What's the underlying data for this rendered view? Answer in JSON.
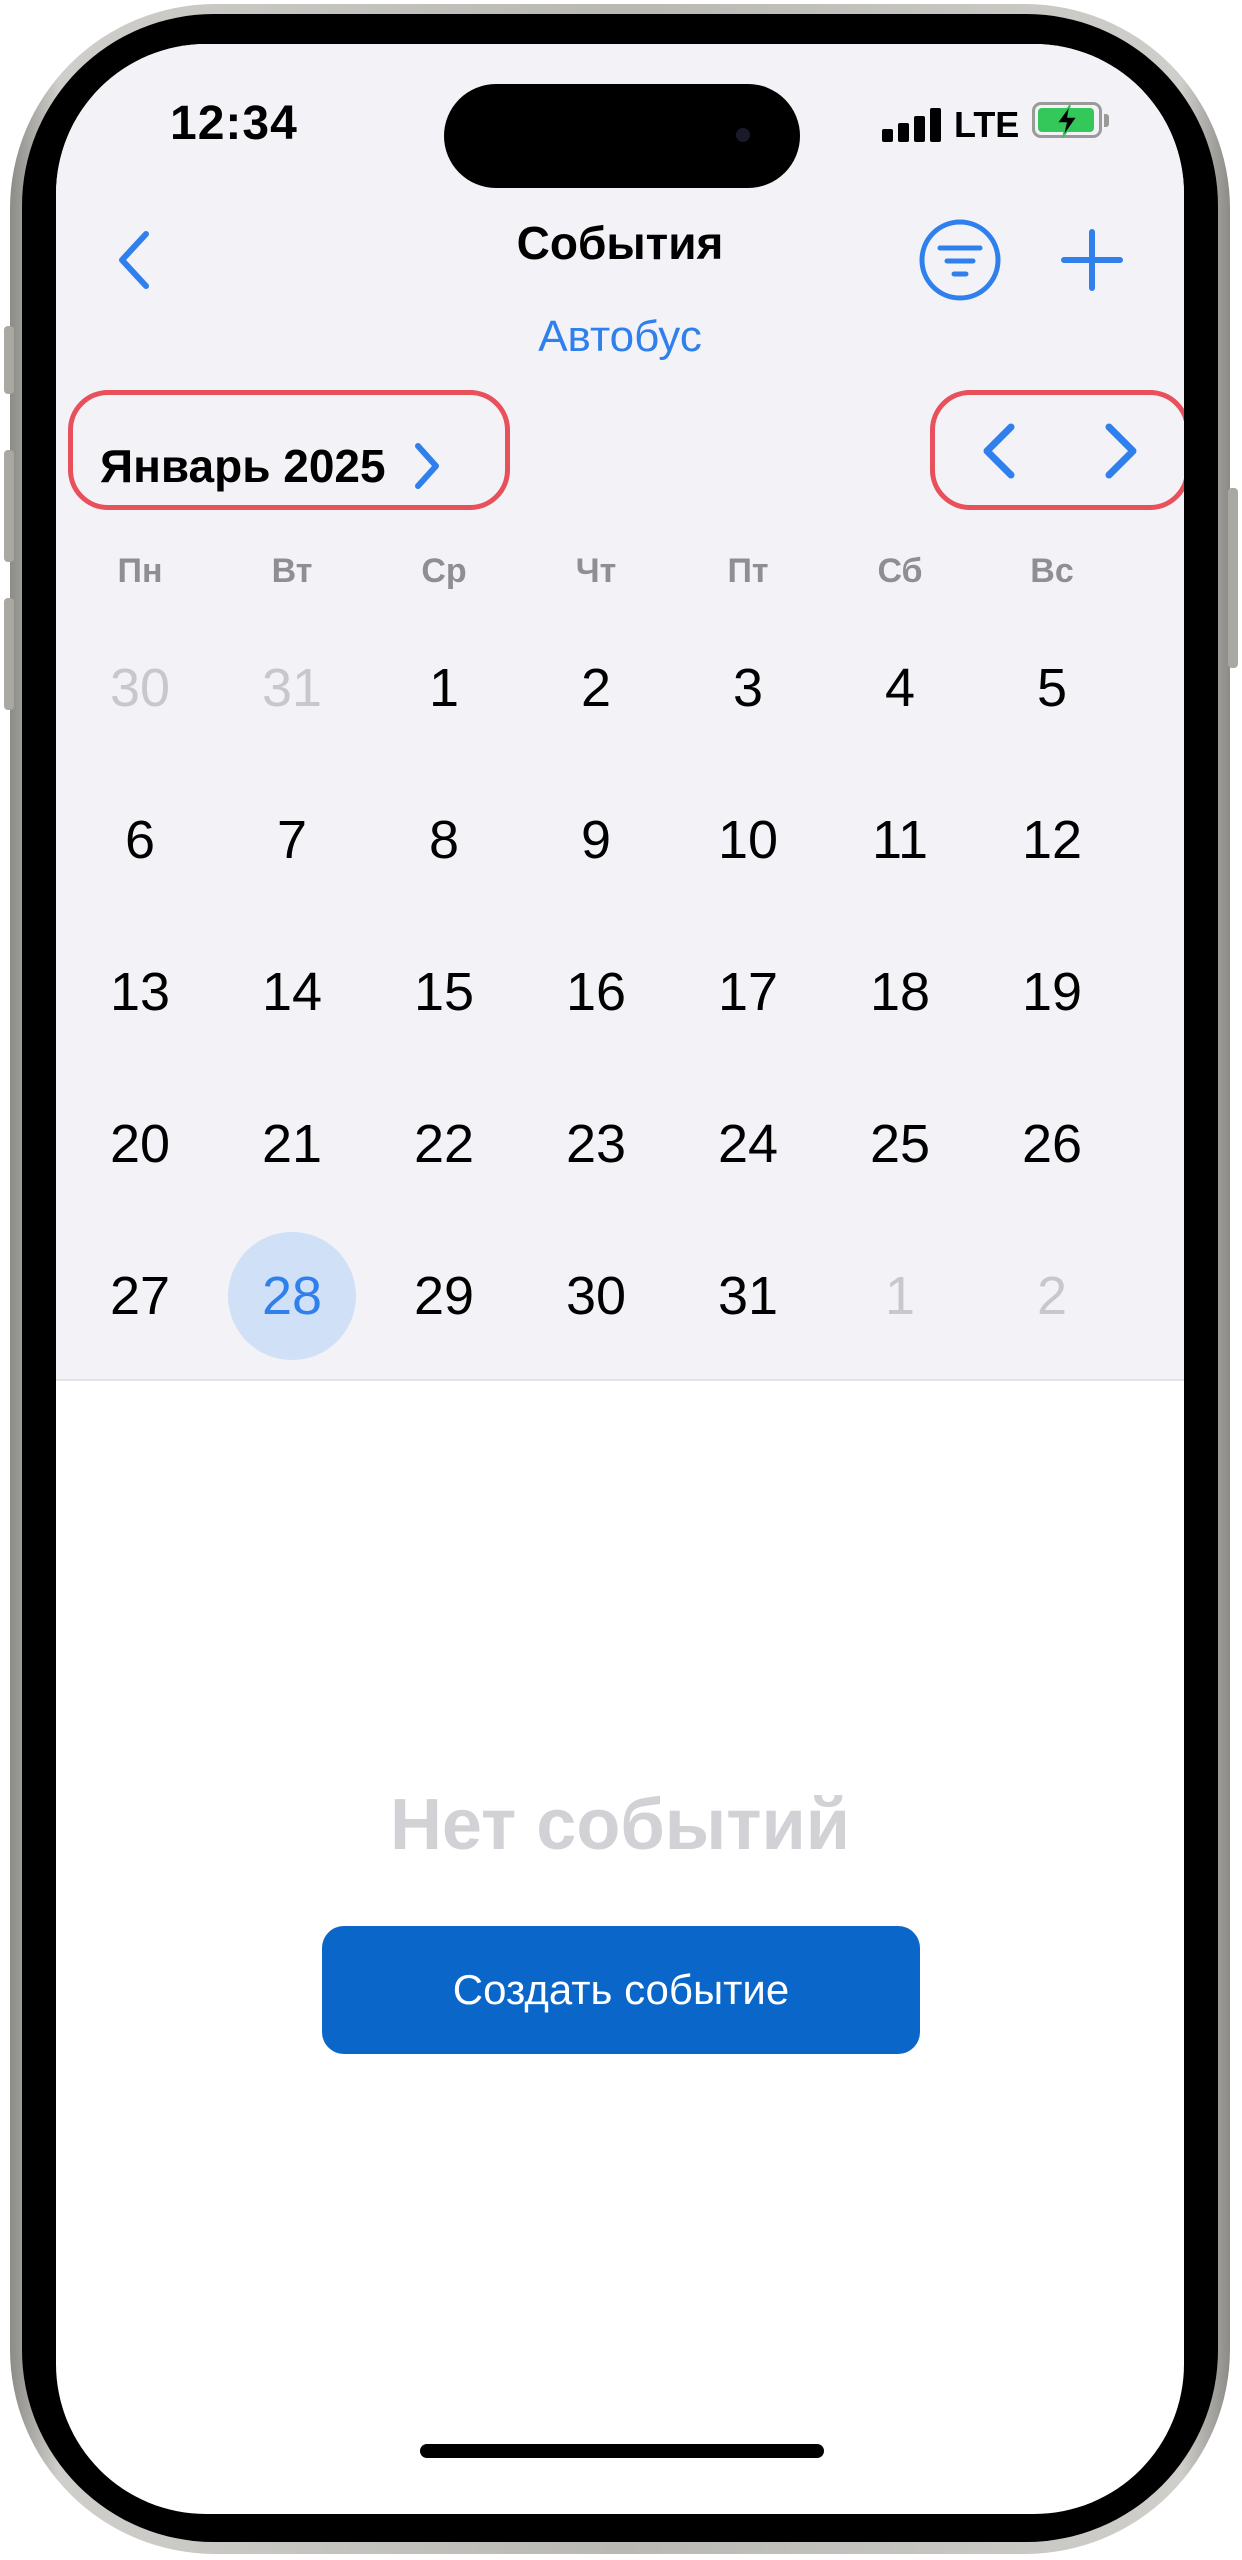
{
  "status_bar": {
    "time": "12:34",
    "network": "LTE",
    "battery_state": "charging",
    "battery_color": "#34c759"
  },
  "nav": {
    "back_icon": "chevron-left-icon",
    "title": "События",
    "filter_icon": "filter-circle-icon",
    "add_icon": "plus-icon",
    "subtitle": "Автобус"
  },
  "calendar": {
    "month_label": "Январь 2025",
    "weekdays": [
      "Пн",
      "Вт",
      "Ср",
      "Чт",
      "Пт",
      "Сб",
      "Вс"
    ],
    "weeks": [
      [
        {
          "d": "30",
          "muted": true
        },
        {
          "d": "31",
          "muted": true
        },
        {
          "d": "1"
        },
        {
          "d": "2"
        },
        {
          "d": "3"
        },
        {
          "d": "4"
        },
        {
          "d": "5"
        }
      ],
      [
        {
          "d": "6"
        },
        {
          "d": "7"
        },
        {
          "d": "8"
        },
        {
          "d": "9"
        },
        {
          "d": "10"
        },
        {
          "d": "11"
        },
        {
          "d": "12"
        }
      ],
      [
        {
          "d": "13"
        },
        {
          "d": "14"
        },
        {
          "d": "15"
        },
        {
          "d": "16"
        },
        {
          "d": "17"
        },
        {
          "d": "18"
        },
        {
          "d": "19"
        }
      ],
      [
        {
          "d": "20"
        },
        {
          "d": "21"
        },
        {
          "d": "22"
        },
        {
          "d": "23"
        },
        {
          "d": "24"
        },
        {
          "d": "25"
        },
        {
          "d": "26"
        }
      ],
      [
        {
          "d": "27"
        },
        {
          "d": "28",
          "selected": true
        },
        {
          "d": "29"
        },
        {
          "d": "30"
        },
        {
          "d": "31"
        },
        {
          "d": "1",
          "muted": true
        },
        {
          "d": "2",
          "muted": true
        }
      ]
    ],
    "selected_day": "28"
  },
  "empty_state": {
    "message": "Нет событий",
    "button_label": "Создать событие"
  },
  "colors": {
    "accent": "#2f80ed",
    "button_bg": "#0a66c8",
    "highlight": "#e8505b",
    "header_bg": "#f2f2f7",
    "selected_bg": "#cfe0f7"
  }
}
